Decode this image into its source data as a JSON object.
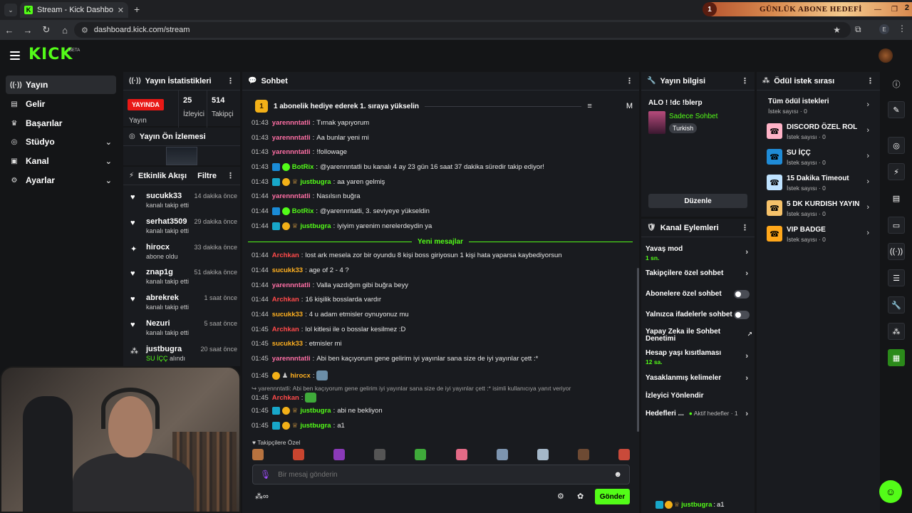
{
  "browser": {
    "tab_title": "Stream - Kick Dashboard",
    "url": "dashboard.kick.com/stream",
    "overlay_badge": "1",
    "overlay_label": "GÜNLÜK ABONE HEDEFİ",
    "overlay_count": "2",
    "profile_letter": "E"
  },
  "brand": {
    "logo": "KICK",
    "beta": "BETA",
    "accent": "#53fc18"
  },
  "leftnav": [
    {
      "label": "Yayın",
      "icon": "broadcast-icon"
    },
    {
      "label": "Gelir",
      "icon": "revenue-icon"
    },
    {
      "label": "Başarılar",
      "icon": "trophy-icon"
    },
    {
      "label": "Stüdyo",
      "icon": "studio-icon"
    },
    {
      "label": "Kanal",
      "icon": "channel-icon"
    },
    {
      "label": "Ayarlar",
      "icon": "settings-icon"
    }
  ],
  "stats": {
    "title": "Yayın İstatistikleri",
    "live_badge": "YAYINDA",
    "live_label": "Yayın",
    "viewers_num": "25",
    "viewers_label": "İzleyici",
    "followers_num": "514",
    "followers_label": "Takipçi"
  },
  "preview": {
    "title": "Yayın Ön İzlemesi"
  },
  "activity": {
    "title": "Etkinlik Akışı",
    "filter": "Filtre",
    "items": [
      {
        "name": "sucukk33",
        "time": "14 dakika önce",
        "desc": "kanalı takip etti"
      },
      {
        "name": "serhat3509",
        "time": "29 dakika önce",
        "desc": "kanalı takip etti"
      },
      {
        "name": "hirocx",
        "time": "33 dakika önce",
        "desc": "abone oldu"
      },
      {
        "name": "znap1g",
        "time": "51 dakika önce",
        "desc": "kanalı takip etti"
      },
      {
        "name": "abrekrek",
        "time": "1 saat önce",
        "desc": "kanalı takip etti"
      },
      {
        "name": "Nezuri",
        "time": "5 saat önce",
        "desc": "kanalı takip etti"
      },
      {
        "name": "justbugra",
        "time": "20 saat önce",
        "desc_green": "SU İÇÇ",
        "desc": "alındı"
      }
    ]
  },
  "chat": {
    "title": "Sohbet",
    "pinned_badge": "1",
    "pinned": "1 abonelik hediye ederek 1. sıraya yükselin",
    "pinned_m": "M",
    "new_messages": "Yeni mesajlar",
    "reply_preview": "↪ yarennntatli: Abi ben kaçıyorum gene gelirim iyi yayınlar sana size de iyi yayınlar çett :* isimli kullanıcıya yanıt veriyor",
    "followers_only": "Takipçilere Özel",
    "input_placeholder": "Bir mesaj gönderin",
    "send": "Gönder",
    "messages": [
      {
        "t": "01:43",
        "u": "yarennntatli",
        "c": "#ff6fa5",
        "m": "Tırnak yapıyorum"
      },
      {
        "t": "01:43",
        "u": "yarennntatli",
        "c": "#ff6fa5",
        "m": "Aa bunlar yeni mi"
      },
      {
        "t": "01:43",
        "u": "yarennntatli",
        "c": "#ff6fa5",
        "m": "!followage"
      },
      {
        "t": "01:43",
        "u": "BotRix",
        "c": "#53fc18",
        "m": "@yarennntatli bu kanalı 4 ay 23 gün 16 saat 37 dakika süredir takip ediyor!",
        "bot": true
      },
      {
        "t": "01:43",
        "u": "justbugra",
        "c": "#53fc18",
        "m": "aa yaren gelmiş",
        "sub": true
      },
      {
        "t": "01:44",
        "u": "yarennntatli",
        "c": "#ff6fa5",
        "m": "Nasılsın buğra"
      },
      {
        "t": "01:44",
        "u": "BotRix",
        "c": "#53fc18",
        "m": "@yarennntatli, 3. seviyeye yükseldin",
        "bot": true
      },
      {
        "t": "01:44",
        "u": "justbugra",
        "c": "#53fc18",
        "m": "iyiyim yarenim nerelerdeydin ya",
        "sub": true
      },
      {
        "t": "01:44",
        "u": "Archkan",
        "c": "#ff4a4a",
        "m": "lost ark mesela zor bir oyundu 8 kişi boss giriyosun 1 kişi hata yaparsa kaybediyorsun"
      },
      {
        "t": "01:44",
        "u": "sucukk33",
        "c": "#ffb020",
        "m": "age of 2 - 4 ?"
      },
      {
        "t": "01:44",
        "u": "yarennntatli",
        "c": "#ff6fa5",
        "m": "Valla yazdığım gibi buğra beyy"
      },
      {
        "t": "01:44",
        "u": "Archkan",
        "c": "#ff4a4a",
        "m": "16 kişilik bosslarda vardır"
      },
      {
        "t": "01:44",
        "u": "sucukk33",
        "c": "#ffb020",
        "m": "4 u adam etmisler oynuyonuz mu"
      },
      {
        "t": "01:45",
        "u": "Archkan",
        "c": "#ff4a4a",
        "m": "lol kitlesi ile o bosslar kesilmez :D"
      },
      {
        "t": "01:45",
        "u": "sucukk33",
        "c": "#ffb020",
        "m": "etmisler mi"
      },
      {
        "t": "01:45",
        "u": "yarennntatli",
        "c": "#ff6fa5",
        "m": "Abi ben kaçıyorum gene gelirim iyi yayınlar sana size de iyi yayınlar çett :*"
      },
      {
        "t": "01:45",
        "u": "hirocx",
        "c": "#ffb020",
        "m": "",
        "emote": true,
        "gold": true
      },
      {
        "t": "01:45",
        "u": "Archkan",
        "c": "#ff4a4a",
        "m": "",
        "emote": true
      },
      {
        "t": "01:45",
        "u": "justbugra",
        "c": "#53fc18",
        "m": "abi ne bekliyon",
        "sub": true
      },
      {
        "t": "01:45",
        "u": "justbugra",
        "c": "#53fc18",
        "m": "a1",
        "sub": true
      }
    ]
  },
  "stream_info": {
    "title": "Yayın bilgisi",
    "stream_title": "ALO ! !dc !blerp",
    "category": "Sadece Sohbet",
    "tag": "Turkish",
    "edit": "Düzenle"
  },
  "channel_actions": {
    "title": "Kanal Eylemleri",
    "items": [
      {
        "label": "Yavaş mod",
        "sub": "1 sn.",
        "type": "chevron"
      },
      {
        "label": "Takipçilere özel sohbet",
        "type": "chevron"
      },
      {
        "label": "Abonelere özel sohbet",
        "type": "toggle"
      },
      {
        "label": "Yalnızca ifadelerle sohbet",
        "type": "toggle"
      },
      {
        "label": "Yapay Zeka ile Sohbet Denetimi",
        "type": "external"
      },
      {
        "label": "Hesap yaşı kısıtlaması",
        "sub": "12 sa.",
        "type": "chevron"
      },
      {
        "label": "Yasaklanmış kelimeler",
        "type": "chevron"
      },
      {
        "label": "İzleyici Yönlendir",
        "type": "none"
      },
      {
        "label": "Hedefleri ...",
        "meta": "Aktif hedefler · 1",
        "type": "chevron"
      }
    ],
    "bottom_user": "justbugra",
    "bottom_msg": "a1"
  },
  "rewards": {
    "title": "Ödül istek sırası",
    "items": [
      {
        "name": "Tüm ödül istekleri",
        "count": "İstek sayısı · 0",
        "color": ""
      },
      {
        "name": "DISCORD ÖZEL ROL",
        "count": "İstek sayısı · 0",
        "color": "#ffb3c7"
      },
      {
        "name": "SU İÇÇ",
        "count": "İstek sayısı · 0",
        "color": "#1f8bd6"
      },
      {
        "name": "15 Dakika Timeout",
        "count": "İstek sayısı · 0",
        "color": "#bfe3ff"
      },
      {
        "name": "5 DK KURDISH YAYIN",
        "count": "İstek sayısı · 0",
        "color": "#f6c26a"
      },
      {
        "name": "VIP BADGE",
        "count": "İstek sayısı · 0",
        "color": "#ffa71a"
      }
    ]
  }
}
